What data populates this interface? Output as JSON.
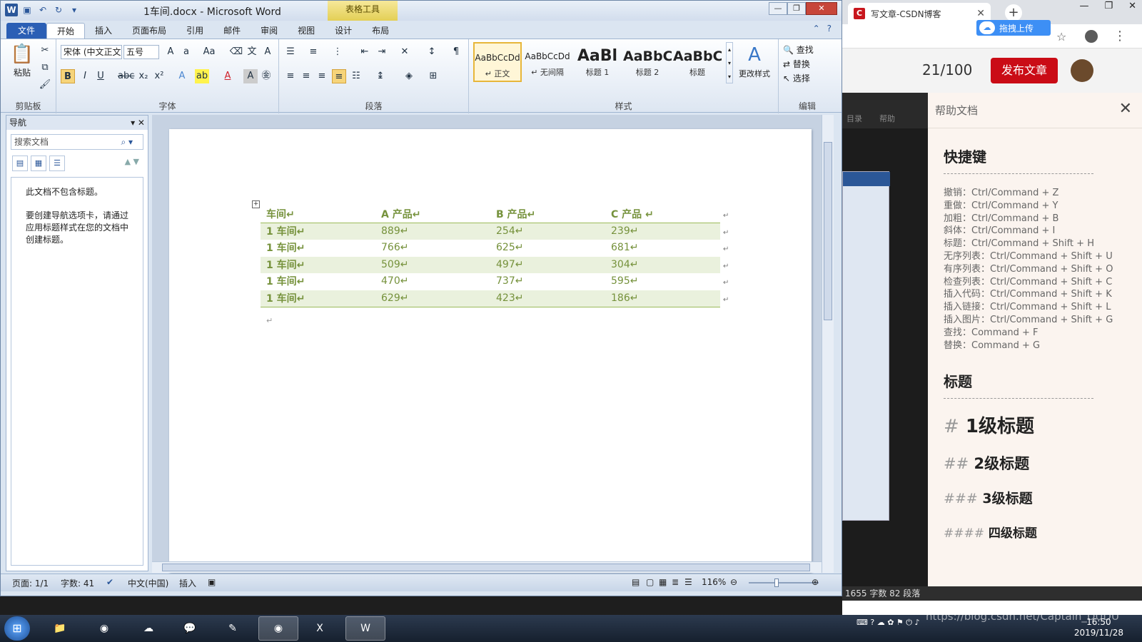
{
  "word": {
    "doc_title": "1车间.docx - Microsoft Word",
    "context_tab": "表格工具",
    "tabs": [
      "文件",
      "开始",
      "插入",
      "页面布局",
      "引用",
      "邮件",
      "审阅",
      "视图",
      "设计",
      "布局"
    ],
    "ribbon": {
      "paste_label": "粘贴",
      "clipboard_label": "剪贴板",
      "font_name": "宋体 (中文正文)",
      "font_size": "五号",
      "font_label": "字体",
      "paragraph_label": "段落",
      "styles_label": "样式",
      "edit_label": "编辑",
      "styles": [
        {
          "preview": "AaBbCcDd",
          "name": "↵ 正文"
        },
        {
          "preview": "AaBbCcDd",
          "name": "↵ 无间隔"
        },
        {
          "preview": "AaBl",
          "name": "标题 1"
        },
        {
          "preview": "AaBbC",
          "name": "标题 2"
        },
        {
          "preview": "AaBbC",
          "name": "标题"
        }
      ],
      "change_styles": "更改样式",
      "find": "查找",
      "replace": "替换",
      "select": "选择"
    },
    "nav": {
      "title": "导航",
      "search_placeholder": "搜索文档",
      "msg1": "此文档不包含标题。",
      "msg2": "要创建导航选项卡，请通过应用标题样式在您的文档中创建标题。"
    },
    "table": {
      "headers": [
        "车间↵",
        "A 产品↵",
        "B 产品↵",
        "C 产品  ↵"
      ],
      "rows": [
        [
          "1 车间↵",
          "889↵",
          "254↵",
          "239↵"
        ],
        [
          "1 车间↵",
          "766↵",
          "625↵",
          "681↵"
        ],
        [
          "1 车间↵",
          "509↵",
          "497↵",
          "304↵"
        ],
        [
          "1 车间↵",
          "470↵",
          "737↵",
          "595↵"
        ],
        [
          "1 车间↵",
          "629↵",
          "423↵",
          "186↵"
        ]
      ]
    },
    "status": {
      "page": "页面: 1/1",
      "words": "字数: 41",
      "lang": "中文(中国)",
      "mode": "插入",
      "zoom": "116%"
    }
  },
  "browser": {
    "tab_title": "写文章-CSDN博客",
    "upload_btn": "拖拽上传",
    "word_count": "21/100",
    "publish_btn": "发布文章",
    "toc_label": "目录",
    "help_btn_label": "帮助",
    "help_title": "帮助文档",
    "help_sections": {
      "shortcut_title": "快捷键",
      "shortcuts": [
        "撤销：Ctrl/Command + Z",
        "重做：Ctrl/Command + Y",
        "加粗：Ctrl/Command + B",
        "斜体：Ctrl/Command + I",
        "标题：Ctrl/Command + Shift + H",
        "无序列表：Ctrl/Command + Shift + U",
        "有序列表：Ctrl/Command + Shift + O",
        "检查列表：Ctrl/Command + Shift + C",
        "插入代码：Ctrl/Command + Shift + K",
        "插入链接：Ctrl/Command + Shift + L",
        "插入图片：Ctrl/Command + Shift + G",
        "查找：Command + F",
        "替换：Command + G"
      ],
      "heading_title": "标题",
      "h1": "1级标题",
      "h2": "2级标题",
      "h3": "3级标题",
      "h4": "四级标题"
    },
    "status_strip": "1655 字数  82 段落"
  },
  "taskbar": {
    "clock_time": "16:50",
    "clock_date": "2019/11/28",
    "watermark": "https://blog.csdn.net/Captain_DUDU"
  },
  "colors": {
    "word_blue": "#2b579a",
    "table_green": "#76923c",
    "band": "#eaf1dd",
    "publish_red": "#ca0c16"
  }
}
